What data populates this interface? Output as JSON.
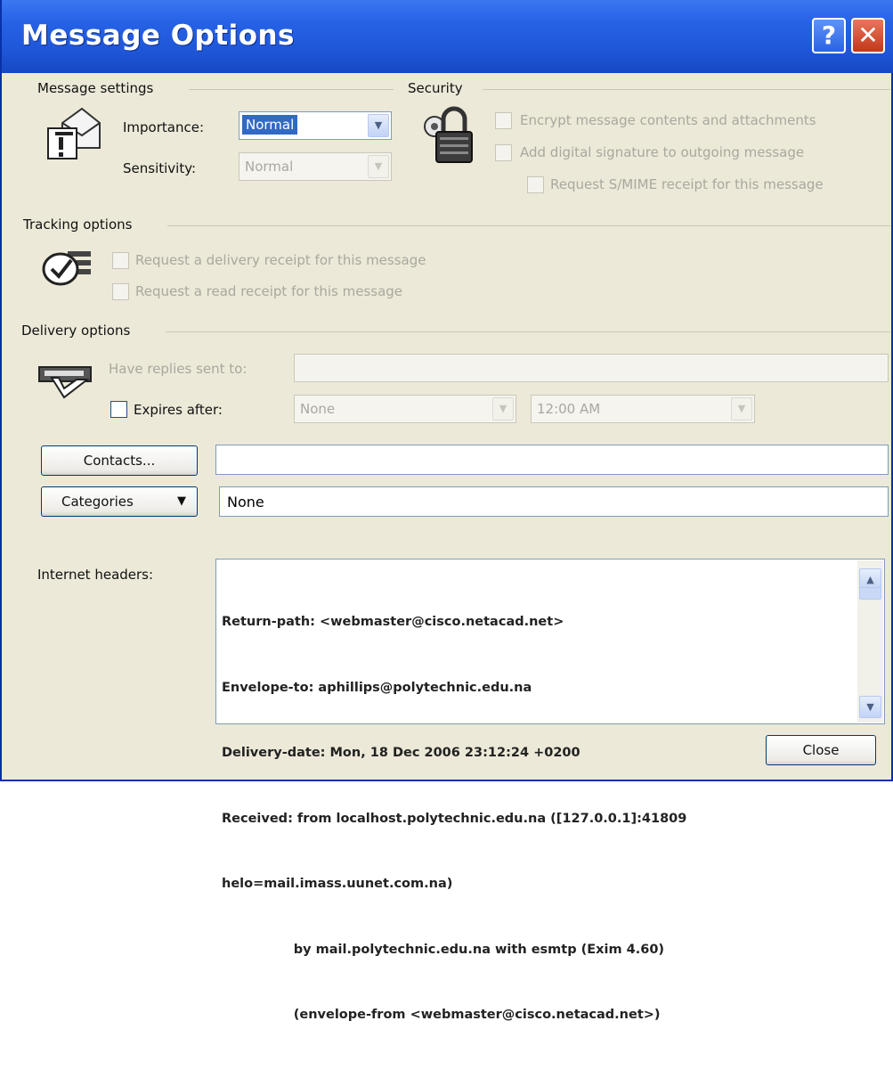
{
  "window": {
    "title": "Message Options",
    "help_glyph": "?",
    "close_glyph": "✕"
  },
  "message_settings": {
    "heading": "Message settings",
    "importance_label": "Importance:",
    "importance_value": "Normal",
    "sensitivity_label": "Sensitivity:",
    "sensitivity_value": "Normal",
    "icon": "message-settings-icon"
  },
  "security": {
    "heading": "Security",
    "encrypt_label": "Encrypt message contents and attachments",
    "signature_label": "Add digital signature to outgoing message",
    "smime_label": "Request S/MIME receipt for this message",
    "icon": "padlock-icon"
  },
  "tracking": {
    "heading": "Tracking options",
    "delivery_receipt_label": "Request a delivery receipt for this message",
    "read_receipt_label": "Request a read receipt for this message",
    "icon": "tracking-icon"
  },
  "delivery": {
    "heading": "Delivery options",
    "replies_label": "Have replies sent to:",
    "replies_value": "",
    "expires_label": "Expires after:",
    "expires_date": "None",
    "expires_time": "12:00 AM",
    "icon": "delivery-icon"
  },
  "contacts": {
    "button_label": "Contacts...",
    "value": ""
  },
  "categories": {
    "button_label": "Categories",
    "value": "None"
  },
  "internet_headers": {
    "label": "Internet headers:",
    "lines": [
      "Return-path: <webmaster@cisco.netacad.net>",
      "Envelope-to: aphillips@polytechnic.edu.na",
      "Delivery-date: Mon, 18 Dec 2006 23:12:24 +0200",
      "Received: from localhost.polytechnic.edu.na ([127.0.0.1]:41809",
      "helo=mail.imass.uunet.com.na)",
      "                by mail.polytechnic.edu.na with esmtp (Exim 4.60)",
      "                (envelope-from <webmaster@cisco.netacad.net>)"
    ]
  },
  "footer": {
    "close_label": "Close"
  }
}
